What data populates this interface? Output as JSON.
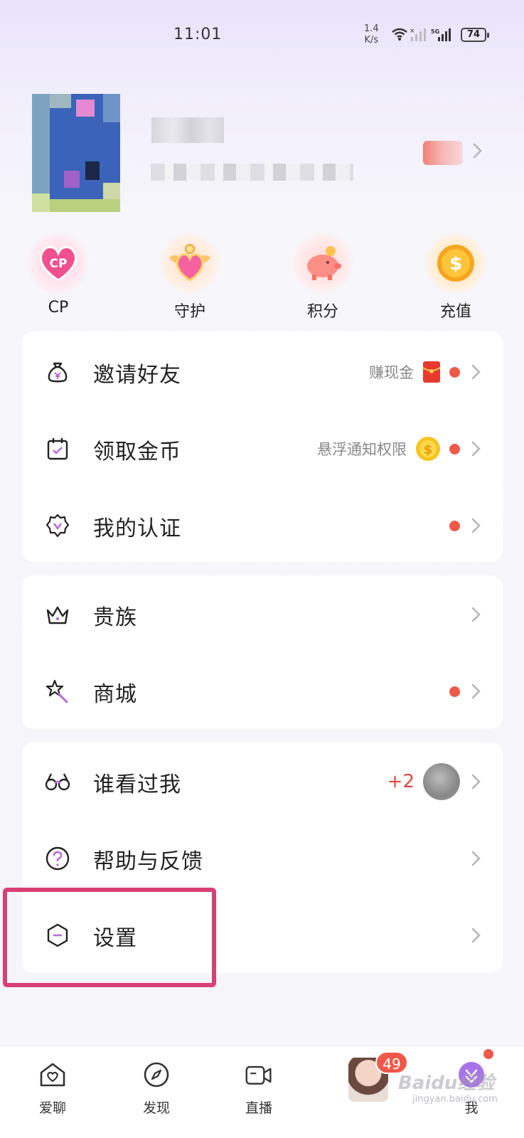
{
  "status_bar": {
    "time": "11:01",
    "net_speed_value": "1.4",
    "net_speed_unit": "K/s",
    "battery": "74"
  },
  "quick_actions": [
    {
      "label": "CP",
      "icon": "cp-heart-icon"
    },
    {
      "label": "守护",
      "icon": "guard-heart-wings-icon"
    },
    {
      "label": "积分",
      "icon": "piggy-bank-icon"
    },
    {
      "label": "充值",
      "icon": "gold-coin-icon"
    }
  ],
  "menu_group_1": {
    "invite": {
      "label": "邀请好友",
      "hint": "赚现金"
    },
    "coins": {
      "label": "领取金币",
      "hint": "悬浮通知权限"
    },
    "verify": {
      "label": "我的认证"
    }
  },
  "menu_group_2": {
    "noble": {
      "label": "贵族"
    },
    "mall": {
      "label": "商城"
    }
  },
  "menu_group_3": {
    "visitors": {
      "label": "谁看过我",
      "count": "+2"
    },
    "help": {
      "label": "帮助与反馈"
    },
    "settings": {
      "label": "设置"
    }
  },
  "bottom_nav": {
    "chat": "爱聊",
    "discover": "发现",
    "live": "直播",
    "badge_count": "49",
    "me": "我"
  },
  "watermark": {
    "main": "Baidu经验",
    "sub": "jingyan.baidu.com"
  },
  "colors": {
    "accent": "#a872e8",
    "red_dot": "#f0584a",
    "highlight": "#d83f72"
  }
}
